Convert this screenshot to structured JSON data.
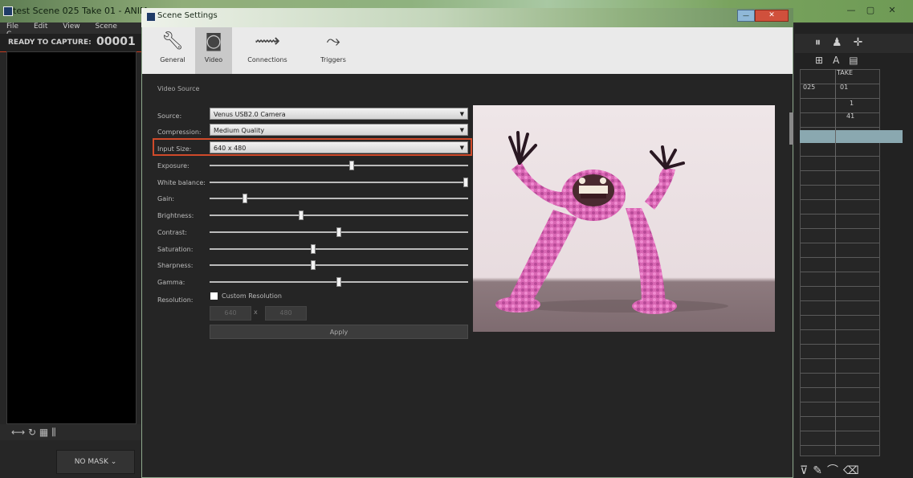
{
  "background_app": {
    "title": "test Scene 025 Take 01 - ANIM",
    "menu": [
      "File",
      "Edit",
      "View",
      "Scene",
      "C"
    ],
    "ready_label": "READY TO CAPTURE:",
    "frame_counter": "00001",
    "no_mask": "NO MASK ⌄",
    "right_panel": {
      "take_label": "TAKE",
      "scene_value": "025",
      "take_value": "01",
      "row3_value": "1",
      "row4_value": "41"
    },
    "window_controls": {
      "minimize": "—",
      "maximize": "▢",
      "close": "✕"
    }
  },
  "dialog": {
    "title": "Scene Settings",
    "close_label": "✕",
    "minimize_label": "—",
    "tabs": [
      {
        "label": "General",
        "icon": "wrench-icon",
        "active": false
      },
      {
        "label": "Video",
        "icon": "camera-icon",
        "active": true
      },
      {
        "label": "Connections",
        "icon": "connections-icon",
        "active": false
      },
      {
        "label": "Triggers",
        "icon": "triggers-icon",
        "active": false
      }
    ],
    "section_label": "Video Source",
    "fields": {
      "source": {
        "label": "Source:",
        "value": "Venus USB2.0 Camera"
      },
      "compression": {
        "label": "Compression:",
        "value": "Medium Quality"
      },
      "input_size": {
        "label": "Input Size:",
        "value": "640 x 480"
      }
    },
    "sliders": [
      {
        "label": "Exposure:",
        "value": 0.55
      },
      {
        "label": "White balance:",
        "value": 1.0
      },
      {
        "label": "Gain:",
        "value": 0.13
      },
      {
        "label": "Brightness:",
        "value": 0.35
      },
      {
        "label": "Contrast:",
        "value": 0.5
      },
      {
        "label": "Saturation:",
        "value": 0.4
      },
      {
        "label": "Sharpness:",
        "value": 0.4
      },
      {
        "label": "Gamma:",
        "value": 0.5
      }
    ],
    "resolution": {
      "label": "Resolution:",
      "checkbox_label": "Custom Resolution",
      "width": "640",
      "separator": "x",
      "height": "480"
    },
    "apply_label": "Apply",
    "highlight_color": "#d04a2a"
  }
}
